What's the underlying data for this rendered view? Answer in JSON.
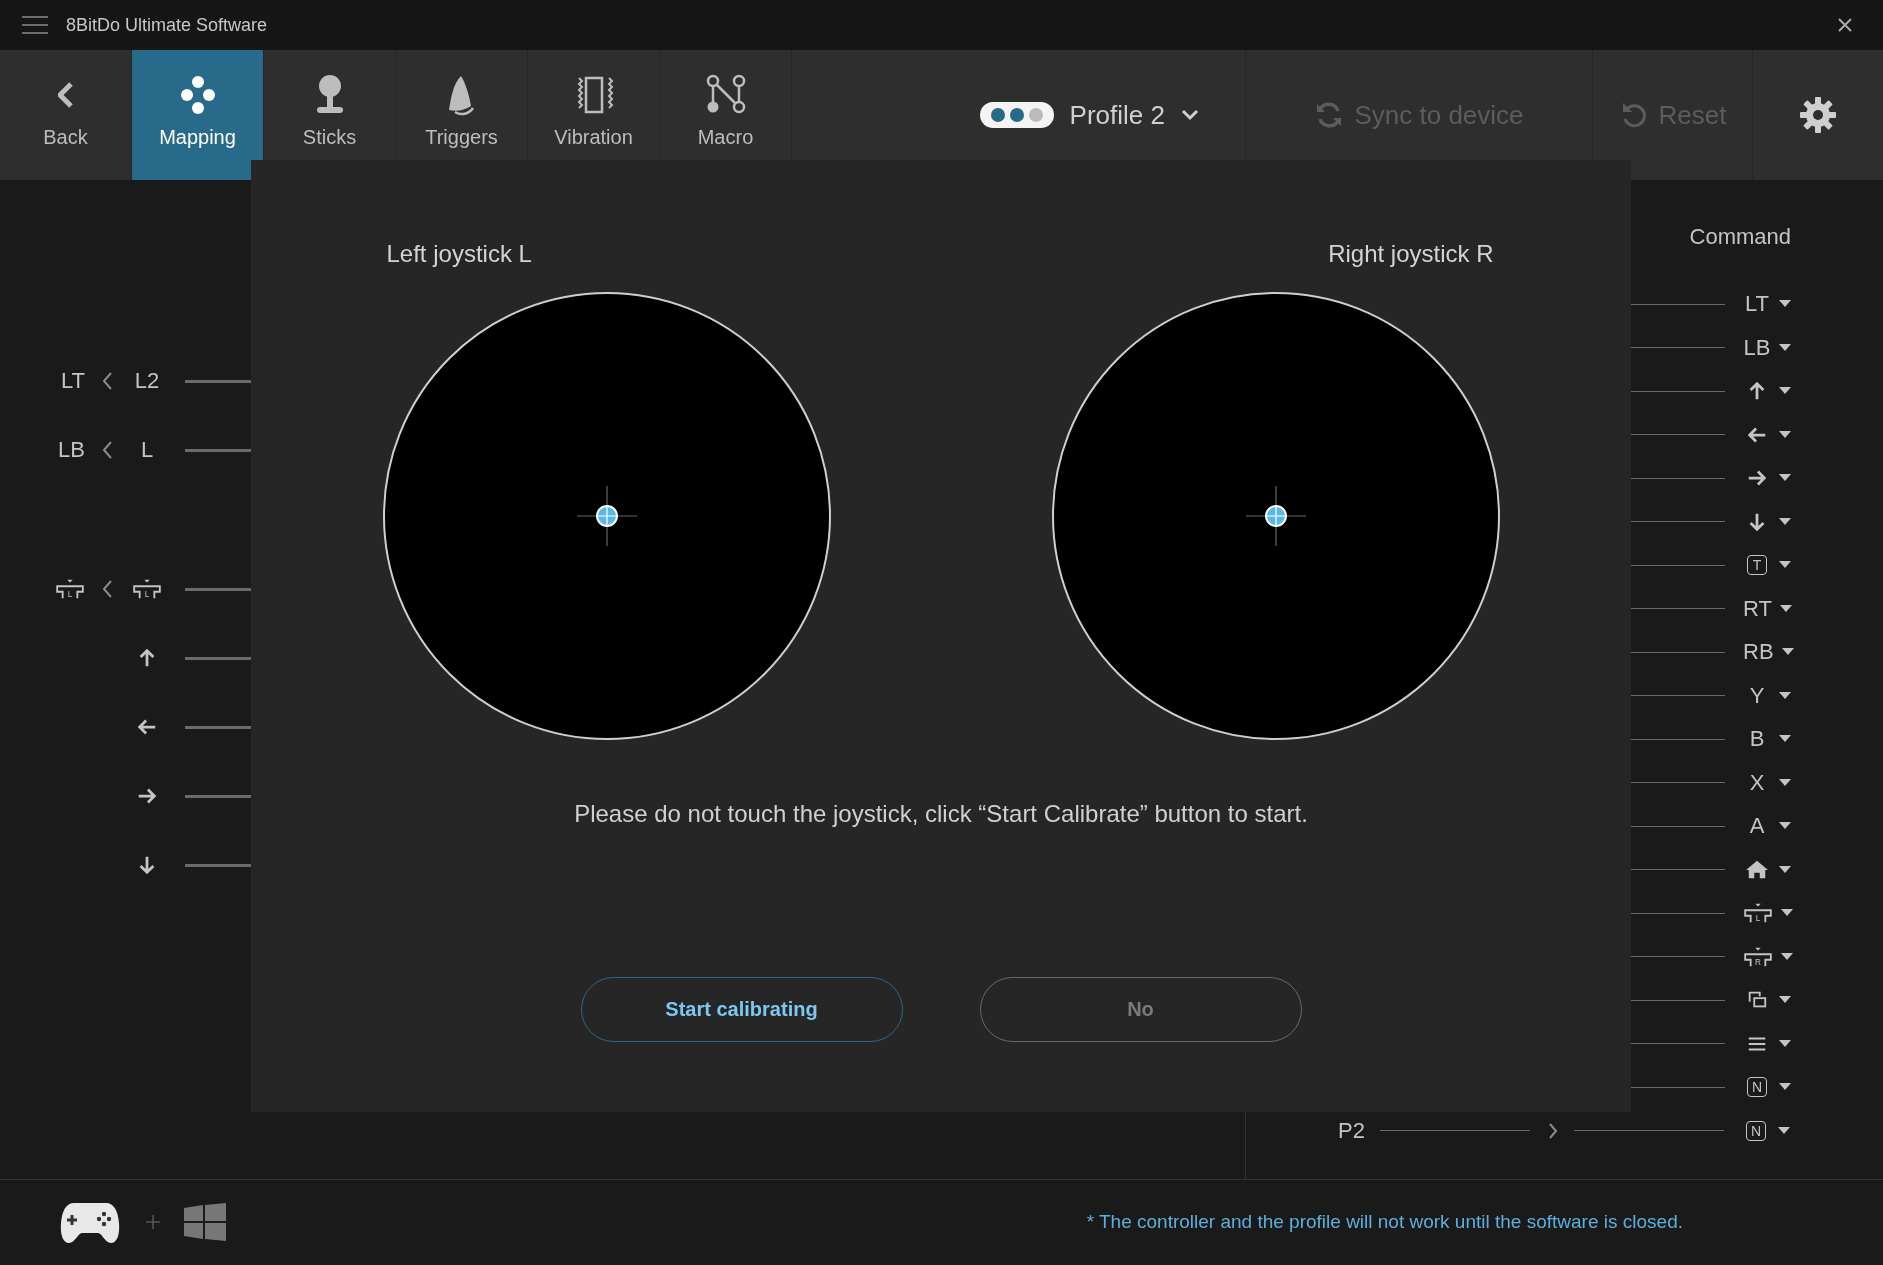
{
  "window": {
    "title": "8BitDo Ultimate Software"
  },
  "toolbar": {
    "back": {
      "label": "Back"
    },
    "tabs": [
      {
        "label": "Mapping",
        "kind": "mapping",
        "selected": true
      },
      {
        "label": "Sticks",
        "kind": "sticks",
        "selected": false
      },
      {
        "label": "Triggers",
        "kind": "triggers",
        "selected": false
      },
      {
        "label": "Vibration",
        "kind": "vibration",
        "selected": false
      },
      {
        "label": "Macro",
        "kind": "macro",
        "selected": false
      }
    ],
    "profile": {
      "name": "Profile 2",
      "slots": [
        {
          "on": true
        },
        {
          "on": true
        },
        {
          "on": false
        }
      ]
    },
    "sync": {
      "label": "Sync to device",
      "disabled": true
    },
    "reset": {
      "label": "Reset",
      "disabled": true
    }
  },
  "left_panel": {
    "groups": [
      {
        "items": [
          {
            "from": {
              "kind": "text",
              "text": "LT"
            },
            "to": {
              "kind": "text",
              "text": "L2"
            }
          },
          {
            "from": {
              "kind": "text",
              "text": "LB"
            },
            "to": {
              "kind": "text",
              "text": "L"
            }
          }
        ]
      },
      {
        "items": [
          {
            "from": {
              "kind": "stick",
              "text": "L"
            },
            "to": {
              "kind": "stick",
              "text": "L"
            }
          },
          {
            "to": {
              "kind": "arrow-up"
            }
          },
          {
            "to": {
              "kind": "arrow-left"
            }
          },
          {
            "to": {
              "kind": "arrow-right"
            }
          },
          {
            "to": {
              "kind": "arrow-down"
            }
          }
        ]
      }
    ]
  },
  "right_panel": {
    "header": "Command",
    "rows": [
      {
        "target": {
          "kind": "text",
          "text": "LT"
        }
      },
      {
        "target": {
          "kind": "text",
          "text": "LB"
        }
      },
      {
        "target": {
          "kind": "arrow-up"
        }
      },
      {
        "target": {
          "kind": "arrow-left"
        }
      },
      {
        "target": {
          "kind": "arrow-right"
        }
      },
      {
        "target": {
          "kind": "arrow-down"
        }
      },
      {
        "target": {
          "kind": "key",
          "text": "T"
        }
      },
      {
        "target": {
          "kind": "text",
          "text": "RT"
        }
      },
      {
        "target": {
          "kind": "text",
          "text": "RB"
        }
      },
      {
        "target": {
          "kind": "text",
          "text": "Y"
        }
      },
      {
        "target": {
          "kind": "text",
          "text": "B"
        }
      },
      {
        "target": {
          "kind": "text",
          "text": "X"
        }
      },
      {
        "target": {
          "kind": "text",
          "text": "A"
        }
      },
      {
        "target": {
          "kind": "home"
        }
      },
      {
        "target": {
          "kind": "stick",
          "text": "L"
        }
      },
      {
        "target": {
          "kind": "stick",
          "text": "R"
        }
      },
      {
        "target": {
          "kind": "capture"
        }
      },
      {
        "target": {
          "kind": "menu"
        }
      },
      {
        "target": {
          "kind": "key",
          "text": "N"
        }
      },
      {
        "source": "P2",
        "target": {
          "kind": "key",
          "text": "N"
        }
      }
    ]
  },
  "dialog": {
    "joysticks": [
      {
        "label": "Left joystick L"
      },
      {
        "label": "Right joystick R"
      }
    ],
    "message": "Please do not touch the joystick, click “Start Calibrate” button to start.",
    "buttons": [
      {
        "label": "Start calibrating",
        "kind": "primary"
      },
      {
        "label": "No",
        "kind": "secondary"
      }
    ]
  },
  "footer": {
    "note": "* The controller and the profile will not work until the software is closed."
  }
}
